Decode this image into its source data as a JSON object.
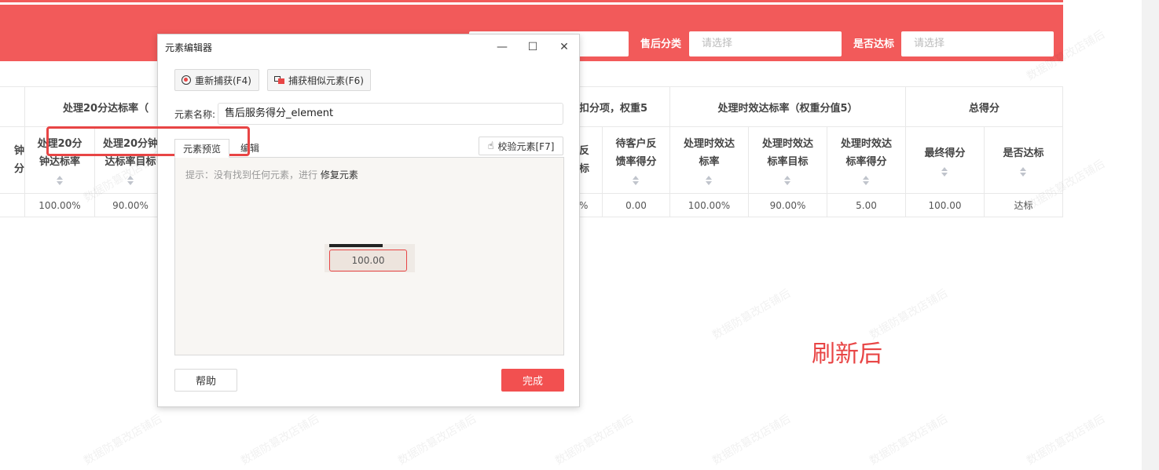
{
  "filters": {
    "aftersale_label": "售后分类",
    "aftersale_placeholder": "请选择",
    "qualified_label": "是否达标",
    "qualified_placeholder": "请选择"
  },
  "table": {
    "group_headers": [
      "处理20分达标率（",
      "扣分项，权重5",
      "处理时效达标率（权重分值5）",
      "总得分"
    ],
    "col_headers": [
      {
        "l1": "钟",
        "l2": "分"
      },
      {
        "l1": "处理20分",
        "l2": "钟达标率"
      },
      {
        "l1": "处理20分钟",
        "l2": "达标率目标"
      },
      {
        "l1": "反",
        "l2": "标"
      },
      {
        "l1": "待客户反",
        "l2": "馈率得分"
      },
      {
        "l1": "处理时效达",
        "l2": "标率"
      },
      {
        "l1": "处理时效达",
        "l2": "标率目标"
      },
      {
        "l1": "处理时效达",
        "l2": "标率得分"
      },
      {
        "l1": "最终得分",
        "l2": ""
      },
      {
        "l1": "是否达标",
        "l2": ""
      }
    ],
    "row": [
      "",
      "100.00%",
      "90.00%",
      "%",
      "0.00",
      "100.00%",
      "90.00%",
      "5.00",
      "100.00",
      "达标"
    ]
  },
  "annotation": "刷新后",
  "watermark": "数据防篡改店铺后",
  "dialog": {
    "title": "元素编辑器",
    "minimize": "—",
    "maximize": "☐",
    "close": "✕",
    "recapture_label": "重新捕获(F4)",
    "capture_similar_label": "捕获相似元素(F6)",
    "name_label": "元素名称:",
    "name_value": "售后服务得分_element",
    "tab_preview": "元素预览",
    "tab_edit": "编辑",
    "verify_label": "校验元素[F7]",
    "hint_prefix": "提示：没有找到任何元素，进行",
    "hint_action": "修复元素",
    "preview_value": "100.00",
    "help_label": "帮助",
    "done_label": "完成"
  }
}
